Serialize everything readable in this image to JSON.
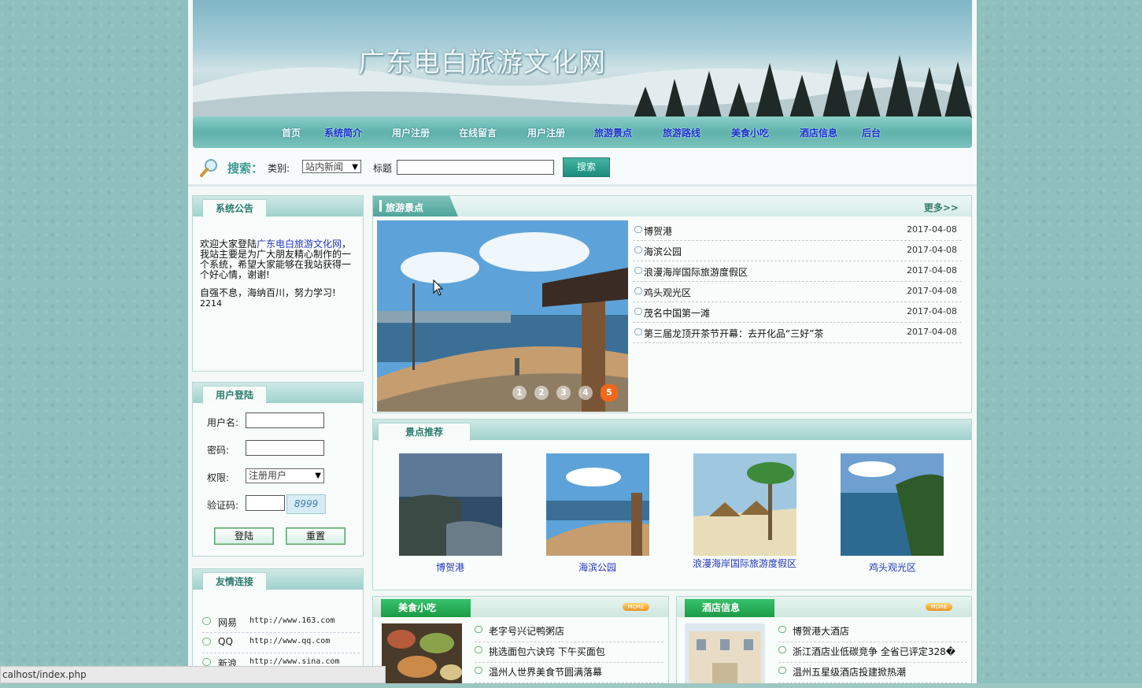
{
  "site": {
    "title": "广东电白旅游文化网"
  },
  "nav": {
    "items": [
      "首页",
      "系统简介",
      "用户注册",
      "在线留言",
      "用户注册",
      "旅游景点",
      "旅游路线",
      "美食小吃",
      "酒店信息",
      "后台"
    ]
  },
  "search": {
    "label": "搜索：",
    "category_label": "类别:",
    "category_value": "站内新闻",
    "title_label": "标题",
    "title_value": "",
    "button": "搜索"
  },
  "notice": {
    "header": "系统公告",
    "line1_pre": "欢迎大家登陆",
    "line1_link": "广东电白旅游文化网",
    "line1_post": "，我站主要是为广大朋友精心制作的一个系统，希望大家能够在我站获得一个好心情，谢谢!",
    "line2": "自强不息，海纳百川，努力学习!",
    "line3": "2214"
  },
  "login": {
    "header": "用户登陆",
    "username_label": "用户名:",
    "password_label": "密码:",
    "role_label": "权限:",
    "role_value": "注册用户",
    "captcha_label": "验证码:",
    "captcha_code": "8999",
    "login_button": "登陆",
    "reset_button": "重置"
  },
  "links": {
    "header": "友情连接",
    "items": [
      {
        "name": "网易",
        "url": "http://www.163.com"
      },
      {
        "name": "QQ",
        "url": "http://www.qq.com"
      },
      {
        "name": "新浪",
        "url": "http://www.sina.com"
      }
    ]
  },
  "scenic": {
    "header": "旅游景点",
    "more": "更多>>",
    "slides": [
      "1",
      "2",
      "3",
      "4",
      "5"
    ],
    "active_slide": 5,
    "news": [
      {
        "title": "博贺港",
        "date": "2017-04-08"
      },
      {
        "title": "海滨公园",
        "date": "2017-04-08"
      },
      {
        "title": "浪漫海岸国际旅游度假区",
        "date": "2017-04-08"
      },
      {
        "title": "鸡头观光区",
        "date": "2017-04-08"
      },
      {
        "title": "茂名中国第一滩",
        "date": "2017-04-08"
      },
      {
        "title": "第三届龙顶开茶节开幕：去开化品“三好”茶",
        "date": "2017-04-08"
      }
    ]
  },
  "recommend": {
    "header": "景点推荐",
    "items": [
      "博贺港",
      "海滨公园",
      "浪漫海岸国际旅游度假区",
      "鸡头观光区"
    ]
  },
  "food": {
    "header": "美食小吃",
    "more": "MORE",
    "items": [
      "老字号兴记鸭粥店",
      "挑选面包六诀窍 下午买面包",
      "温州人世界美食节圆满落幕"
    ]
  },
  "hotel": {
    "header": "酒店信息",
    "more": "MORE",
    "items": [
      "博贺港大酒店",
      "浙江酒店业低碳竞争 全省已评定328�",
      "温州五星级酒店投建掀热潮"
    ]
  },
  "status": {
    "url": "calhost/index.php"
  }
}
